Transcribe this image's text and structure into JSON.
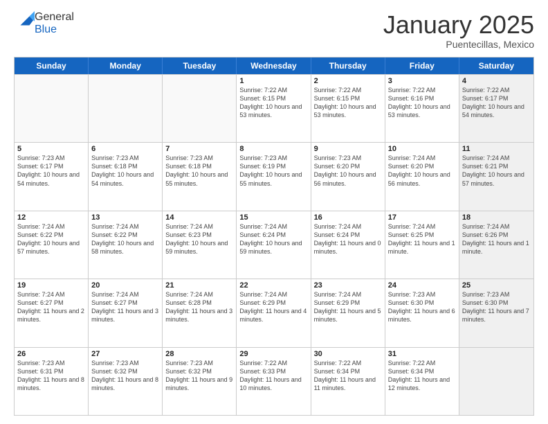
{
  "logo": {
    "general": "General",
    "blue": "Blue"
  },
  "header": {
    "title": "January 2025",
    "location": "Puentecillas, Mexico"
  },
  "weekdays": [
    "Sunday",
    "Monday",
    "Tuesday",
    "Wednesday",
    "Thursday",
    "Friday",
    "Saturday"
  ],
  "rows": [
    [
      {
        "day": "",
        "empty": true
      },
      {
        "day": "",
        "empty": true
      },
      {
        "day": "",
        "empty": true
      },
      {
        "day": "1",
        "sunrise": "7:22 AM",
        "sunset": "6:15 PM",
        "daylight": "10 hours and 53 minutes."
      },
      {
        "day": "2",
        "sunrise": "7:22 AM",
        "sunset": "6:15 PM",
        "daylight": "10 hours and 53 minutes."
      },
      {
        "day": "3",
        "sunrise": "7:22 AM",
        "sunset": "6:16 PM",
        "daylight": "10 hours and 53 minutes."
      },
      {
        "day": "4",
        "sunrise": "7:22 AM",
        "sunset": "6:17 PM",
        "daylight": "10 hours and 54 minutes.",
        "shaded": true
      }
    ],
    [
      {
        "day": "5",
        "sunrise": "7:23 AM",
        "sunset": "6:17 PM",
        "daylight": "10 hours and 54 minutes."
      },
      {
        "day": "6",
        "sunrise": "7:23 AM",
        "sunset": "6:18 PM",
        "daylight": "10 hours and 54 minutes."
      },
      {
        "day": "7",
        "sunrise": "7:23 AM",
        "sunset": "6:18 PM",
        "daylight": "10 hours and 55 minutes."
      },
      {
        "day": "8",
        "sunrise": "7:23 AM",
        "sunset": "6:19 PM",
        "daylight": "10 hours and 55 minutes."
      },
      {
        "day": "9",
        "sunrise": "7:23 AM",
        "sunset": "6:20 PM",
        "daylight": "10 hours and 56 minutes."
      },
      {
        "day": "10",
        "sunrise": "7:24 AM",
        "sunset": "6:20 PM",
        "daylight": "10 hours and 56 minutes."
      },
      {
        "day": "11",
        "sunrise": "7:24 AM",
        "sunset": "6:21 PM",
        "daylight": "10 hours and 57 minutes.",
        "shaded": true
      }
    ],
    [
      {
        "day": "12",
        "sunrise": "7:24 AM",
        "sunset": "6:22 PM",
        "daylight": "10 hours and 57 minutes."
      },
      {
        "day": "13",
        "sunrise": "7:24 AM",
        "sunset": "6:22 PM",
        "daylight": "10 hours and 58 minutes."
      },
      {
        "day": "14",
        "sunrise": "7:24 AM",
        "sunset": "6:23 PM",
        "daylight": "10 hours and 59 minutes."
      },
      {
        "day": "15",
        "sunrise": "7:24 AM",
        "sunset": "6:24 PM",
        "daylight": "10 hours and 59 minutes."
      },
      {
        "day": "16",
        "sunrise": "7:24 AM",
        "sunset": "6:24 PM",
        "daylight": "11 hours and 0 minutes."
      },
      {
        "day": "17",
        "sunrise": "7:24 AM",
        "sunset": "6:25 PM",
        "daylight": "11 hours and 1 minute."
      },
      {
        "day": "18",
        "sunrise": "7:24 AM",
        "sunset": "6:26 PM",
        "daylight": "11 hours and 1 minute.",
        "shaded": true
      }
    ],
    [
      {
        "day": "19",
        "sunrise": "7:24 AM",
        "sunset": "6:27 PM",
        "daylight": "11 hours and 2 minutes."
      },
      {
        "day": "20",
        "sunrise": "7:24 AM",
        "sunset": "6:27 PM",
        "daylight": "11 hours and 3 minutes."
      },
      {
        "day": "21",
        "sunrise": "7:24 AM",
        "sunset": "6:28 PM",
        "daylight": "11 hours and 3 minutes."
      },
      {
        "day": "22",
        "sunrise": "7:24 AM",
        "sunset": "6:29 PM",
        "daylight": "11 hours and 4 minutes."
      },
      {
        "day": "23",
        "sunrise": "7:24 AM",
        "sunset": "6:29 PM",
        "daylight": "11 hours and 5 minutes."
      },
      {
        "day": "24",
        "sunrise": "7:23 AM",
        "sunset": "6:30 PM",
        "daylight": "11 hours and 6 minutes."
      },
      {
        "day": "25",
        "sunrise": "7:23 AM",
        "sunset": "6:30 PM",
        "daylight": "11 hours and 7 minutes.",
        "shaded": true
      }
    ],
    [
      {
        "day": "26",
        "sunrise": "7:23 AM",
        "sunset": "6:31 PM",
        "daylight": "11 hours and 8 minutes."
      },
      {
        "day": "27",
        "sunrise": "7:23 AM",
        "sunset": "6:32 PM",
        "daylight": "11 hours and 8 minutes."
      },
      {
        "day": "28",
        "sunrise": "7:23 AM",
        "sunset": "6:32 PM",
        "daylight": "11 hours and 9 minutes."
      },
      {
        "day": "29",
        "sunrise": "7:22 AM",
        "sunset": "6:33 PM",
        "daylight": "11 hours and 10 minutes."
      },
      {
        "day": "30",
        "sunrise": "7:22 AM",
        "sunset": "6:34 PM",
        "daylight": "11 hours and 11 minutes."
      },
      {
        "day": "31",
        "sunrise": "7:22 AM",
        "sunset": "6:34 PM",
        "daylight": "11 hours and 12 minutes."
      },
      {
        "day": "",
        "empty": true,
        "shaded": true
      }
    ]
  ],
  "labels": {
    "sunrise": "Sunrise:",
    "sunset": "Sunset:",
    "daylight": "Daylight:"
  }
}
